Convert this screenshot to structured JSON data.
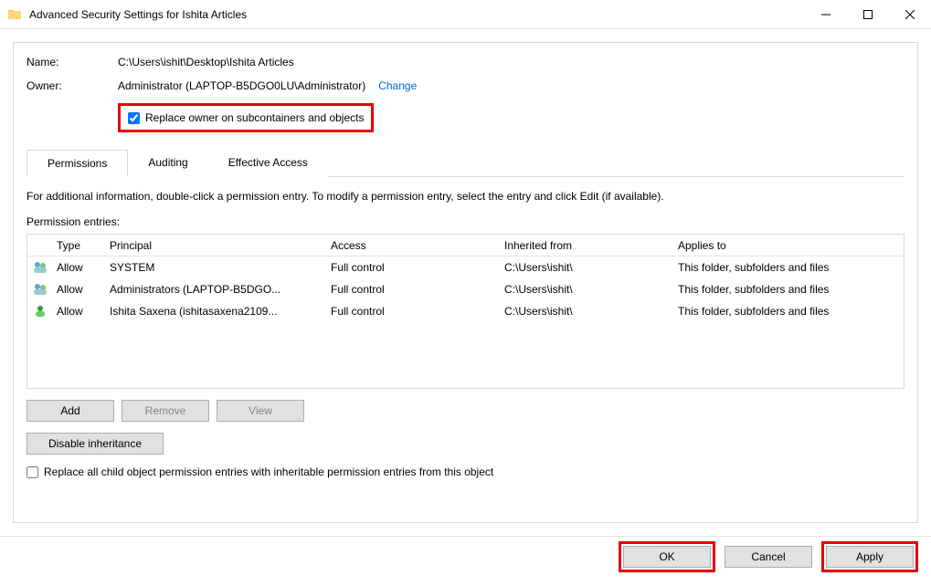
{
  "window": {
    "title": "Advanced Security Settings for Ishita Articles"
  },
  "fields": {
    "name_label": "Name:",
    "name_value": "C:\\Users\\ishit\\Desktop\\Ishita Articles",
    "owner_label": "Owner:",
    "owner_value": "Administrator (LAPTOP-B5DGO0LU\\Administrator)",
    "change_link": "Change",
    "replace_owner_label": "Replace owner on subcontainers and objects",
    "replace_owner_checked": true
  },
  "tabs": {
    "permissions": "Permissions",
    "auditing": "Auditing",
    "effective_access": "Effective Access"
  },
  "info_text": "For additional information, double-click a permission entry. To modify a permission entry, select the entry and click Edit (if available).",
  "pe_label": "Permission entries:",
  "columns": {
    "type": "Type",
    "principal": "Principal",
    "access": "Access",
    "inherited": "Inherited from",
    "applies": "Applies to"
  },
  "entries": [
    {
      "type": "Allow",
      "principal": "SYSTEM",
      "access": "Full control",
      "inherited": "C:\\Users\\ishit\\",
      "applies": "This folder, subfolders and files"
    },
    {
      "type": "Allow",
      "principal": "Administrators (LAPTOP-B5DGO...",
      "access": "Full control",
      "inherited": "C:\\Users\\ishit\\",
      "applies": "This folder, subfolders and files"
    },
    {
      "type": "Allow",
      "principal": "Ishita Saxena (ishitasaxena2109...",
      "access": "Full control",
      "inherited": "C:\\Users\\ishit\\",
      "applies": "This folder, subfolders and files"
    }
  ],
  "buttons": {
    "add": "Add",
    "remove": "Remove",
    "view": "View",
    "disable_inh": "Disable inheritance",
    "ok": "OK",
    "cancel": "Cancel",
    "apply": "Apply"
  },
  "bottom_cb": {
    "label": "Replace all child object permission entries with inheritable permission entries from this object",
    "checked": false
  }
}
